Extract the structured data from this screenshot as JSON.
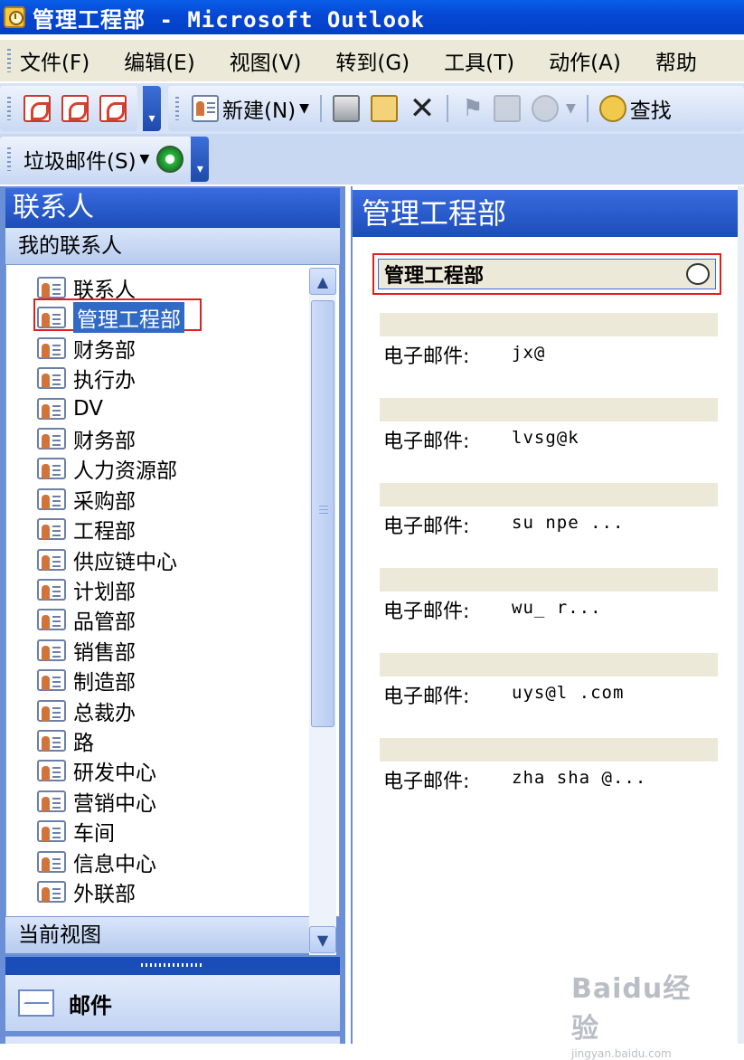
{
  "window": {
    "title": "管理工程部 - Microsoft Outlook"
  },
  "menu": [
    "文件(F)",
    "编辑(E)",
    "视图(V)",
    "转到(G)",
    "工具(T)",
    "动作(A)",
    "帮助"
  ],
  "toolbar": {
    "new_label": "新建(N)",
    "find_label": "查找",
    "junk_label": "垃圾邮件(S)"
  },
  "nav": {
    "header": "联系人",
    "section": "我的联系人",
    "contacts": [
      {
        "label": "联系人",
        "selected": false
      },
      {
        "label": "管理工程部",
        "selected": true
      },
      {
        "label": "财务部",
        "selected": false
      },
      {
        "label": "执行办",
        "selected": false
      },
      {
        "label": "DV",
        "selected": false
      },
      {
        "label": "财务部",
        "selected": false
      },
      {
        "label": "人力资源部",
        "selected": false
      },
      {
        "label": "采购部",
        "selected": false
      },
      {
        "label": "工程部",
        "selected": false
      },
      {
        "label": "供应链中心",
        "selected": false
      },
      {
        "label": "计划部",
        "selected": false
      },
      {
        "label": "品管部",
        "selected": false
      },
      {
        "label": "销售部",
        "selected": false
      },
      {
        "label": "制造部",
        "selected": false
      },
      {
        "label": "总裁办",
        "selected": false
      },
      {
        "label": "路",
        "selected": false
      },
      {
        "label": "研发中心",
        "selected": false
      },
      {
        "label": "营销中心",
        "selected": false
      },
      {
        "label": "车间",
        "selected": false
      },
      {
        "label": "信息中心",
        "selected": false
      },
      {
        "label": "外联部",
        "selected": false
      }
    ],
    "current_view": "当前视图",
    "mail": "邮件"
  },
  "content": {
    "title": "管理工程部",
    "group_name": "管理工程部",
    "cards": [
      {
        "email_label": "电子邮件:",
        "email": "jx@"
      },
      {
        "email_label": "电子邮件:",
        "email": "lvsg@k"
      },
      {
        "email_label": "电子邮件:",
        "email": "su  npe       ..."
      },
      {
        "email_label": "电子邮件:",
        "email": "wu_        r..."
      },
      {
        "email_label": "电子邮件:",
        "email": "uys@l     .com"
      },
      {
        "email_label": "电子邮件:",
        "email": "zha  sha     @..."
      }
    ]
  },
  "watermark": {
    "brand": "Baidu经验",
    "url": "jingyan.baidu.com"
  }
}
